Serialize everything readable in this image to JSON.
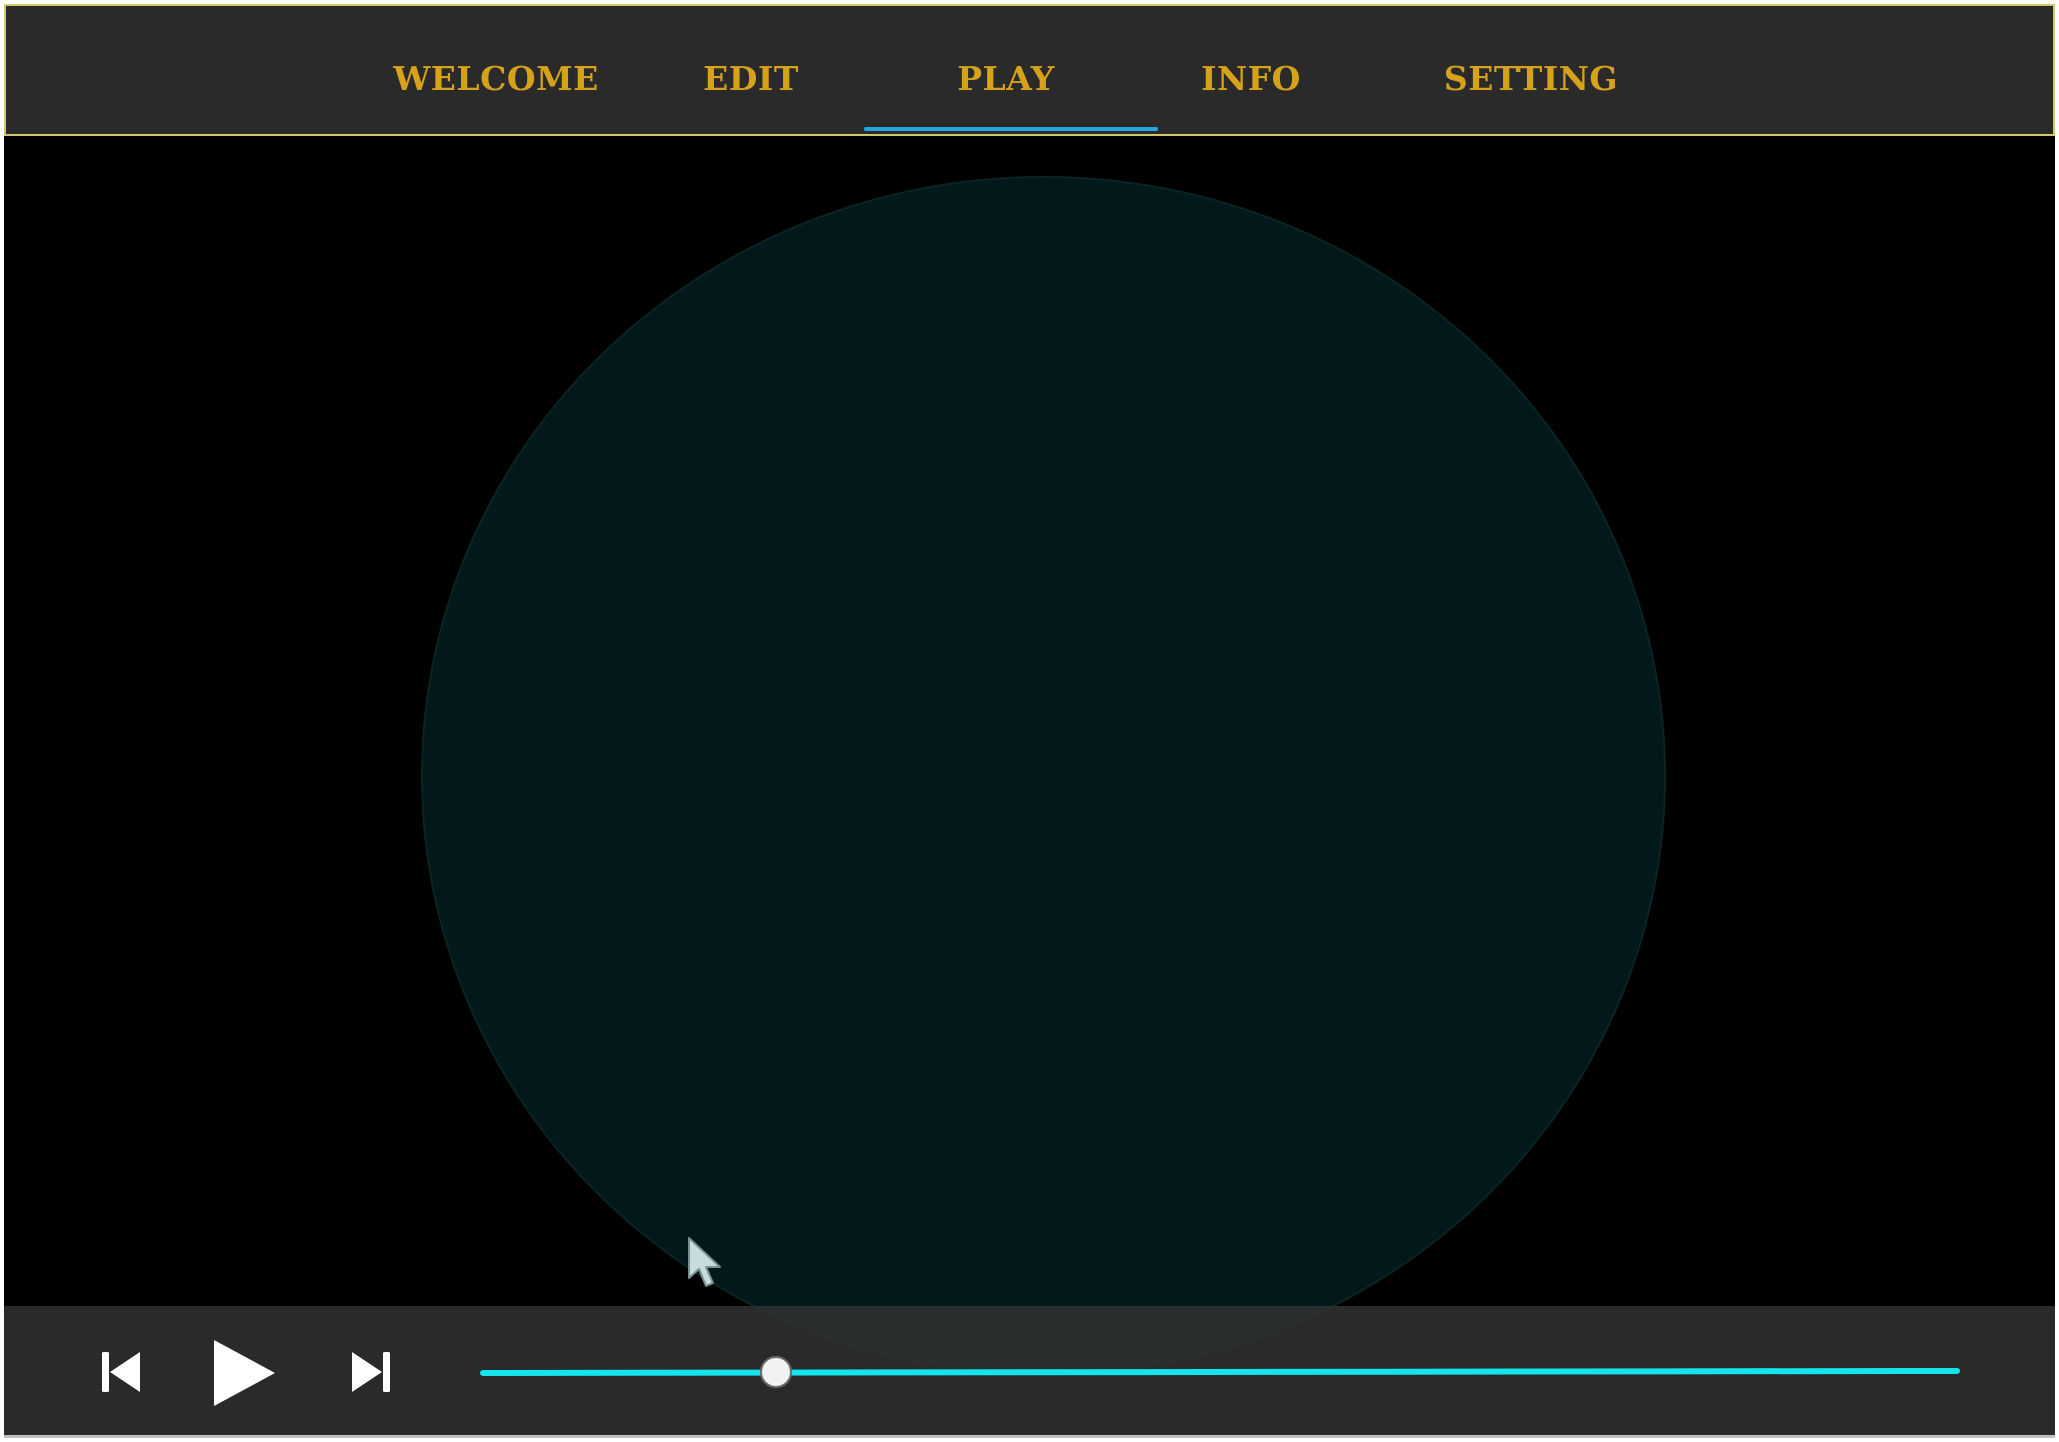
{
  "nav": {
    "tabs": [
      {
        "id": "welcome",
        "label": "WELCOME"
      },
      {
        "id": "edit",
        "label": "EDIT"
      },
      {
        "id": "play",
        "label": "PLAY"
      },
      {
        "id": "info",
        "label": "INFO"
      },
      {
        "id": "setting",
        "label": "SETTING"
      }
    ],
    "active_tab": "PLAY"
  },
  "player": {
    "prev_icon": "skip-previous-icon",
    "play_icon": "play-icon",
    "next_icon": "skip-next-icon",
    "progress_fraction": 0.2
  },
  "colors": {
    "nav_background": "#2a2a2a",
    "nav_border": "#cfc86a",
    "tab_text": "#d6a21a",
    "active_underline": "#27a4e0",
    "stage_background": "#000000",
    "visual_circle": "#03181a",
    "controls_background": "#303030",
    "seek_track": "#12e6ea",
    "seek_thumb": "#f2f2f2",
    "icon_color": "#ffffff"
  }
}
